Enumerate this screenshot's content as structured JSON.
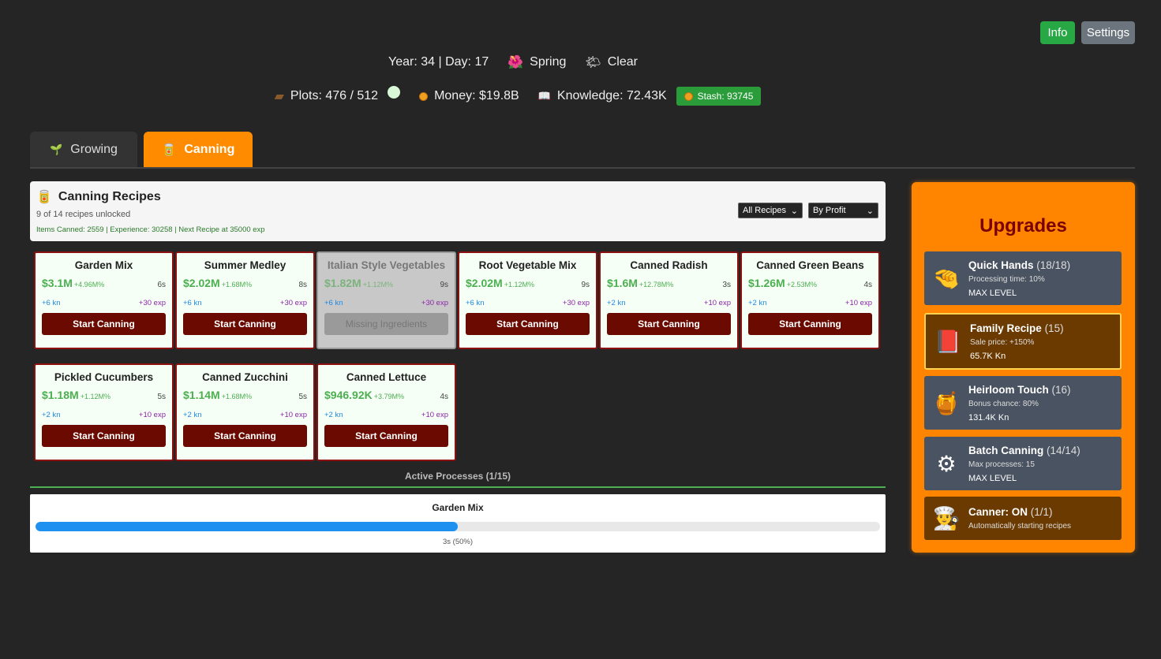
{
  "top_buttons": {
    "info": "Info",
    "settings": "Settings"
  },
  "status": {
    "year_day": "Year: 34 | Day: 17",
    "season": "Spring",
    "season_icon": "flower-icon",
    "weather": "Clear",
    "weather_icon": "sun-cloud-icon",
    "plots": "Plots: 476 / 512",
    "money": "Money: $19.8B",
    "knowledge": "Knowledge: 72.43K",
    "stash": "Stash: 93745"
  },
  "tabs": [
    {
      "label": "Growing",
      "icon": "sprout-icon",
      "active": false
    },
    {
      "label": "Canning",
      "icon": "jar-icon",
      "active": true
    }
  ],
  "header": {
    "title": "Canning Recipes",
    "unlocked": "9 of 14 recipes unlocked",
    "stats": "Items Canned: 2559 | Experience: 30258 | Next Recipe at 35000 exp",
    "filter": "All Recipes",
    "sort": "By Profit"
  },
  "recipes": [
    {
      "name": "Garden Mix",
      "price": "$3.1M",
      "pct": "+4.96M%",
      "time": "6s",
      "kn": "+6 kn",
      "exp": "+30 exp",
      "button": "Start Canning",
      "disabled": false
    },
    {
      "name": "Summer Medley",
      "price": "$2.02M",
      "pct": "+1.68M%",
      "time": "8s",
      "kn": "+6 kn",
      "exp": "+30 exp",
      "button": "Start Canning",
      "disabled": false
    },
    {
      "name": "Italian Style Vegetables",
      "price": "$1.82M",
      "pct": "+1.12M%",
      "time": "9s",
      "kn": "+6 kn",
      "exp": "+30 exp",
      "button": "Missing Ingredients",
      "disabled": true
    },
    {
      "name": "Root Vegetable Mix",
      "price": "$2.02M",
      "pct": "+1.12M%",
      "time": "9s",
      "kn": "+6 kn",
      "exp": "+30 exp",
      "button": "Start Canning",
      "disabled": false
    },
    {
      "name": "Canned Radish",
      "price": "$1.6M",
      "pct": "+12.78M%",
      "time": "3s",
      "kn": "+2 kn",
      "exp": "+10 exp",
      "button": "Start Canning",
      "disabled": false
    },
    {
      "name": "Canned Green Beans",
      "price": "$1.26M",
      "pct": "+2.53M%",
      "time": "4s",
      "kn": "+2 kn",
      "exp": "+10 exp",
      "button": "Start Canning",
      "disabled": false
    },
    {
      "name": "Pickled Cucumbers",
      "price": "$1.18M",
      "pct": "+1.12M%",
      "time": "5s",
      "kn": "+2 kn",
      "exp": "+10 exp",
      "button": "Start Canning",
      "disabled": false
    },
    {
      "name": "Canned Zucchini",
      "price": "$1.14M",
      "pct": "+1.68M%",
      "time": "5s",
      "kn": "+2 kn",
      "exp": "+10 exp",
      "button": "Start Canning",
      "disabled": false
    },
    {
      "name": "Canned Lettuce",
      "price": "$946.92K",
      "pct": "+3.79M%",
      "time": "4s",
      "kn": "+2 kn",
      "exp": "+10 exp",
      "button": "Start Canning",
      "disabled": false
    }
  ],
  "active": {
    "label": "Active Processes (1/15)",
    "process_name": "Garden Mix",
    "progress": 0.5,
    "time_text": "3s (50%)"
  },
  "upgrades": {
    "title": "Upgrades",
    "items": [
      {
        "name": "Quick Hands",
        "level": "(18/18)",
        "desc": "Processing time: 10%",
        "cost": "MAX LEVEL",
        "icon": "hand-icon"
      },
      {
        "name": "Family Recipe",
        "level": "(15)",
        "desc": "Sale price: +150%",
        "cost": "65.7K Kn",
        "icon": "recipe-book-icon"
      },
      {
        "name": "Heirloom Touch",
        "level": "(16)",
        "desc": "Bonus chance: 80%",
        "cost": "131.4K Kn",
        "icon": "jars-icon"
      },
      {
        "name": "Batch Canning",
        "level": "(14/14)",
        "desc": "Max processes: 15",
        "cost": "MAX LEVEL",
        "icon": "canner-machine-icon"
      },
      {
        "name": "Canner: ON",
        "level": "(1/1)",
        "desc": "Automatically starting recipes",
        "cost": "",
        "icon": "chef-icon"
      }
    ]
  }
}
